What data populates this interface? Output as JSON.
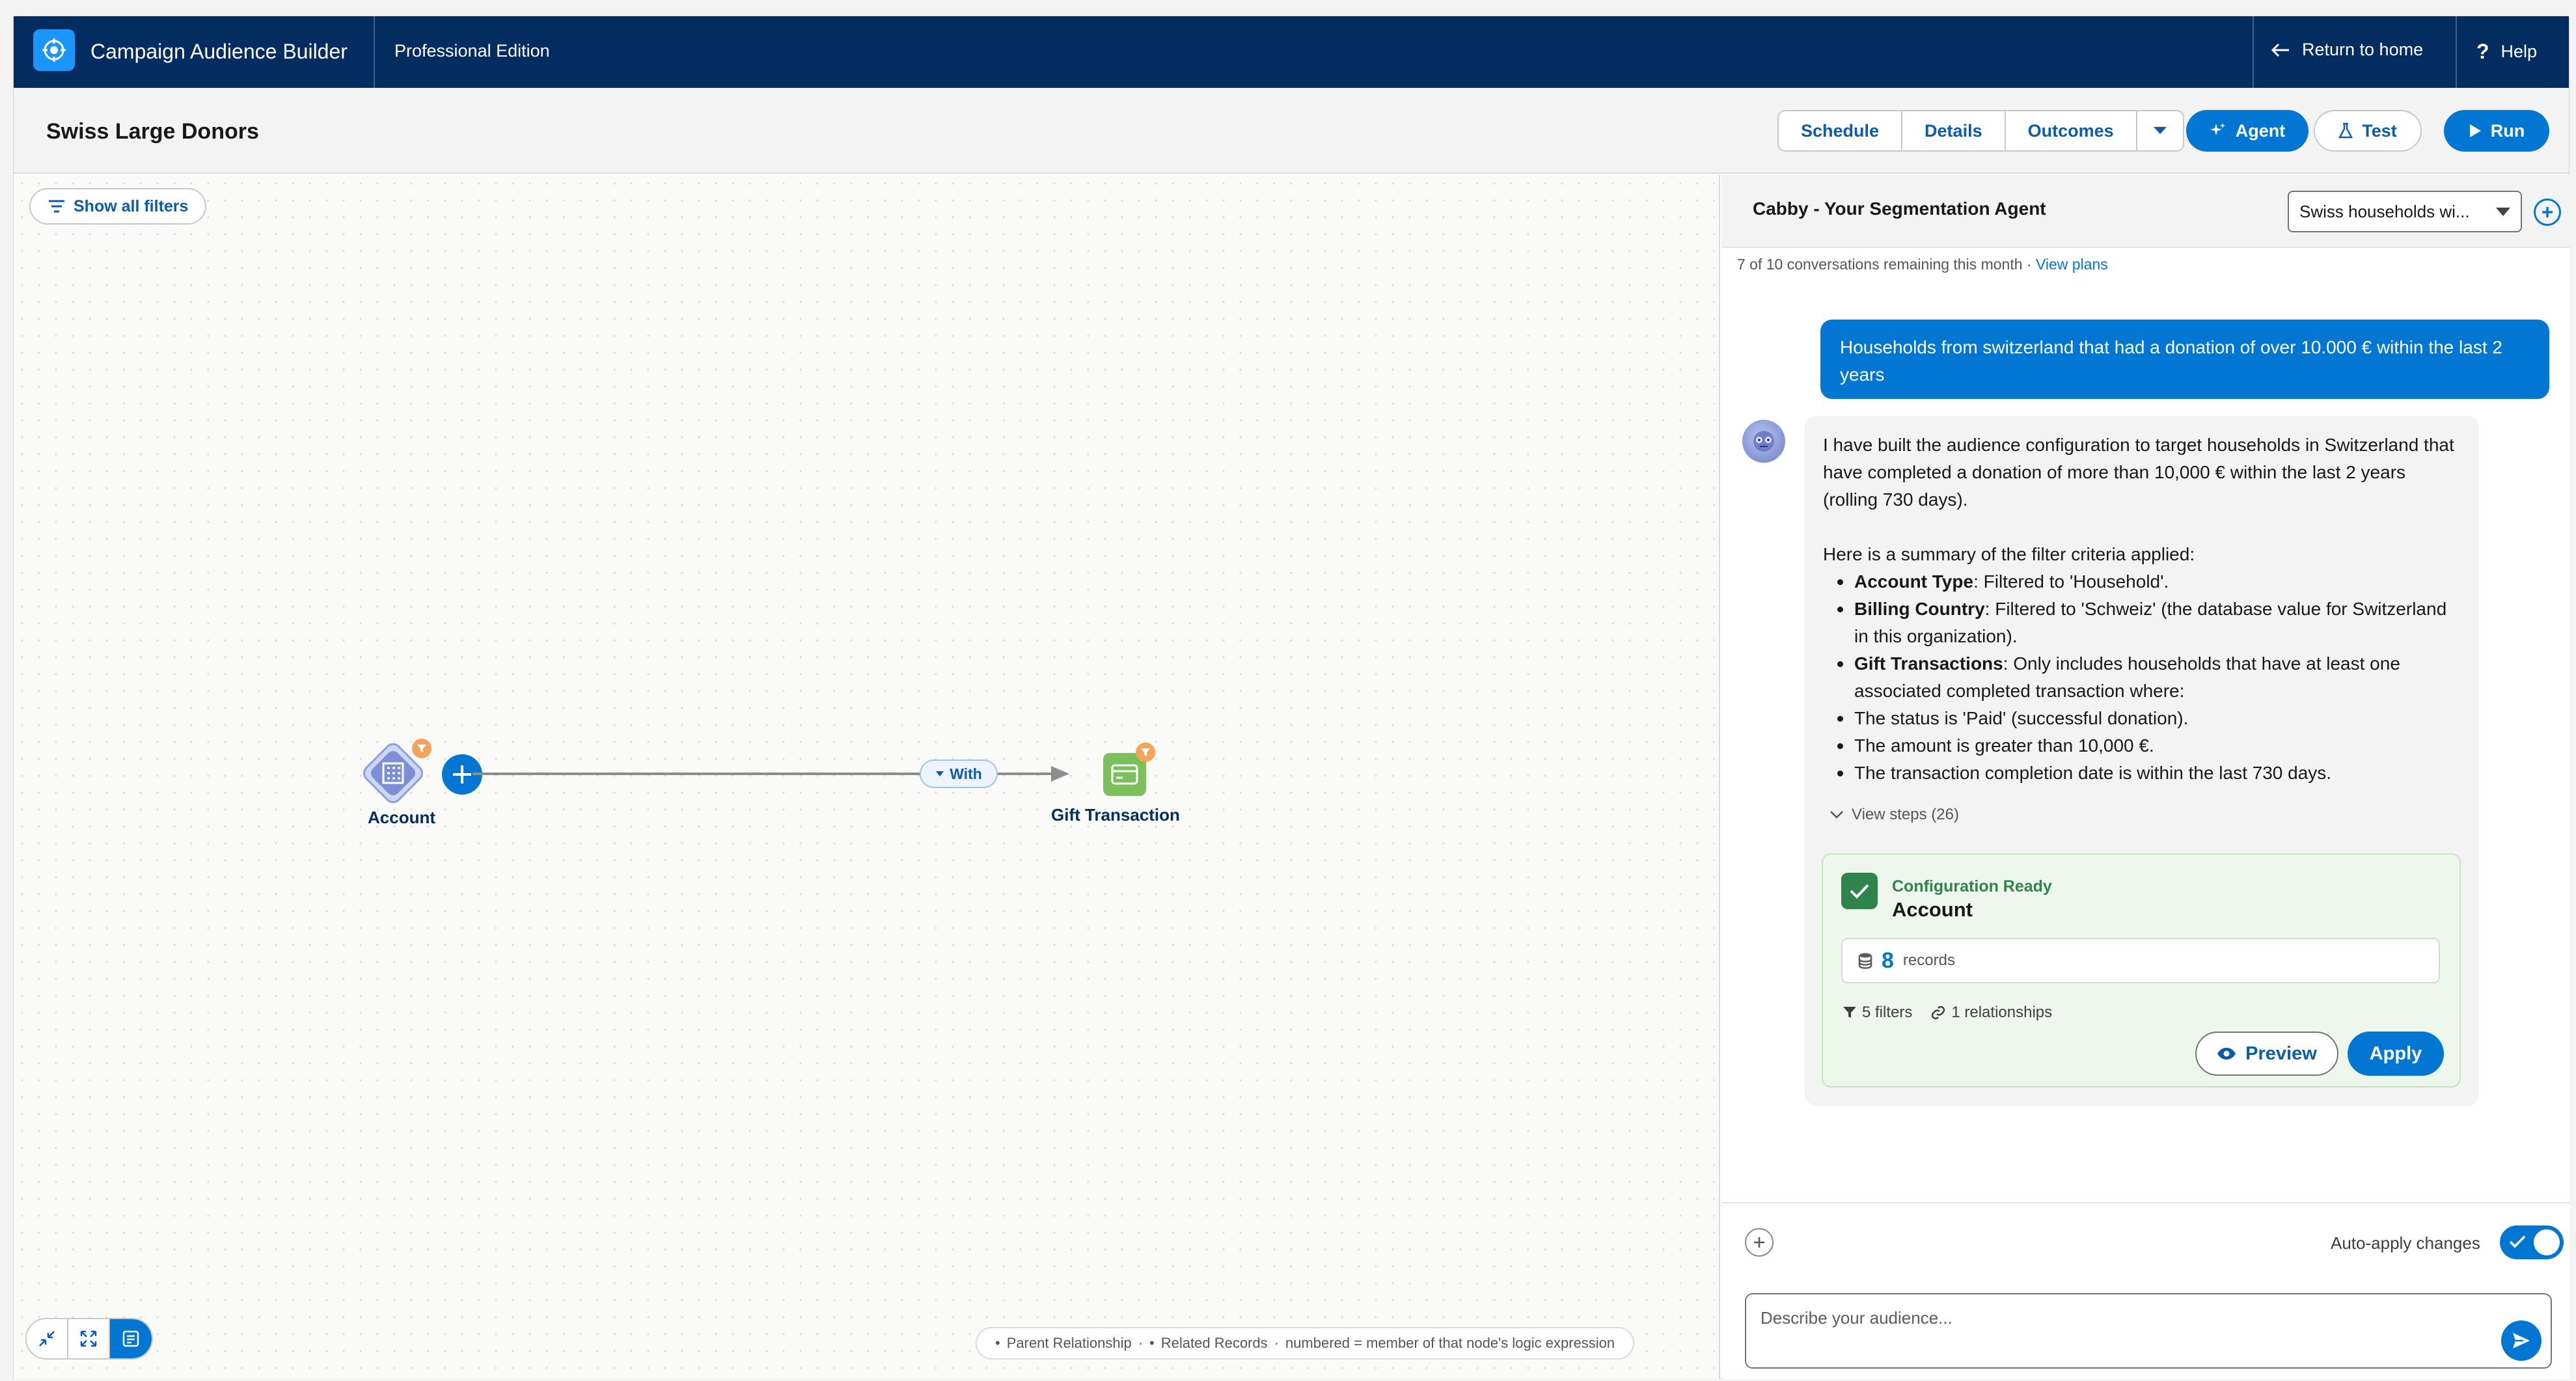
{
  "app": {
    "name": "Campaign Audience Builder",
    "edition": "Professional Edition",
    "return_home": "Return to home",
    "help": "Help"
  },
  "header": {
    "title": "Swiss Large Donors",
    "tabs": [
      "Schedule",
      "Details",
      "Outcomes"
    ],
    "agent": "Agent",
    "test": "Test",
    "run": "Run"
  },
  "canvas": {
    "show_filters": "Show all filters",
    "nodes": [
      {
        "label": "Account",
        "icon": "building-icon"
      },
      {
        "label": "Gift Transaction",
        "icon": "card-icon"
      }
    ],
    "edge_label": "With",
    "legend": {
      "parent": "Parent Relationship",
      "related": "Related Records",
      "numbered": "numbered = member of that node's logic expression"
    },
    "zoom_controls": [
      "collapse-icon",
      "fit-view-icon",
      "minimap-icon"
    ]
  },
  "agent_panel": {
    "title": "Cabby - Your Segmentation Agent",
    "conversation": "Swiss households wi...",
    "remaining": "7 of 10 conversations remaining this month · ",
    "view_plans": "View plans",
    "user_message": "Households from switzerland that had a donation of over 10.000 € within the last 2 years",
    "bot_intro": "I have built the audience configuration to target households in Switzerland that have completed a donation of more than 10,000 € within the last 2 years (rolling 730 days).",
    "summary_heading": "Here is a summary of the filter criteria applied:",
    "criteria": [
      {
        "bold": "Account Type",
        "text": ": Filtered to 'Household'."
      },
      {
        "bold": "Billing Country",
        "text": ": Filtered to 'Schweiz' (the database value for Switzerland in this organization)."
      },
      {
        "bold": "Gift Transactions",
        "text": ": Only includes households that have at least one associated completed transaction where:"
      },
      {
        "bold": "",
        "text": "The status is 'Paid' (successful donation)."
      },
      {
        "bold": "",
        "text": "The amount is greater than 10,000 €."
      },
      {
        "bold": "",
        "text": "The transaction completion date is within the last 730 days."
      }
    ],
    "view_steps": "View steps (26)",
    "config": {
      "status": "Configuration Ready",
      "object": "Account",
      "records_count": "8",
      "records_label": "records",
      "filters": "5 filters",
      "relationships": "1 relationships",
      "preview": "Preview",
      "apply": "Apply"
    },
    "auto_apply": "Auto-apply changes",
    "auto_apply_on": true,
    "input_placeholder": "Describe your audience..."
  },
  "colors": {
    "nav": "#032d60",
    "primary": "#0176d3",
    "success": "#2e844a",
    "badge": "#f4a35a"
  }
}
